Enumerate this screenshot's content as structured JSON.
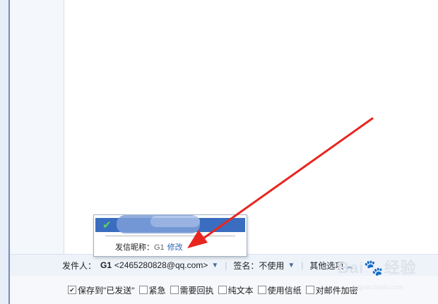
{
  "sender": {
    "label": "发件人：",
    "name": "G1",
    "address": "<2465280828@qq.com>",
    "signature_label": "签名：",
    "signature_value": "不使用",
    "more_options": "其他选项",
    "separator": "|"
  },
  "popup": {
    "nickname_label": "发信昵称：",
    "nickname_value": "G1",
    "edit_link": "修改"
  },
  "options": [
    {
      "label": "保存到\"已发送\"",
      "checked": true
    },
    {
      "label": "紧急",
      "checked": false
    },
    {
      "label": "需要回执",
      "checked": false
    },
    {
      "label": "纯文本",
      "checked": false
    },
    {
      "label": "使用信纸",
      "checked": false
    },
    {
      "label": "对邮件加密",
      "checked": false
    }
  ],
  "watermark": {
    "text": "Bai🐾经验",
    "sub": "jingyan.baidu.com"
  },
  "colors": {
    "accent": "#3a6dbf",
    "arrow": "#e8261f",
    "check": "#5fd35f"
  }
}
